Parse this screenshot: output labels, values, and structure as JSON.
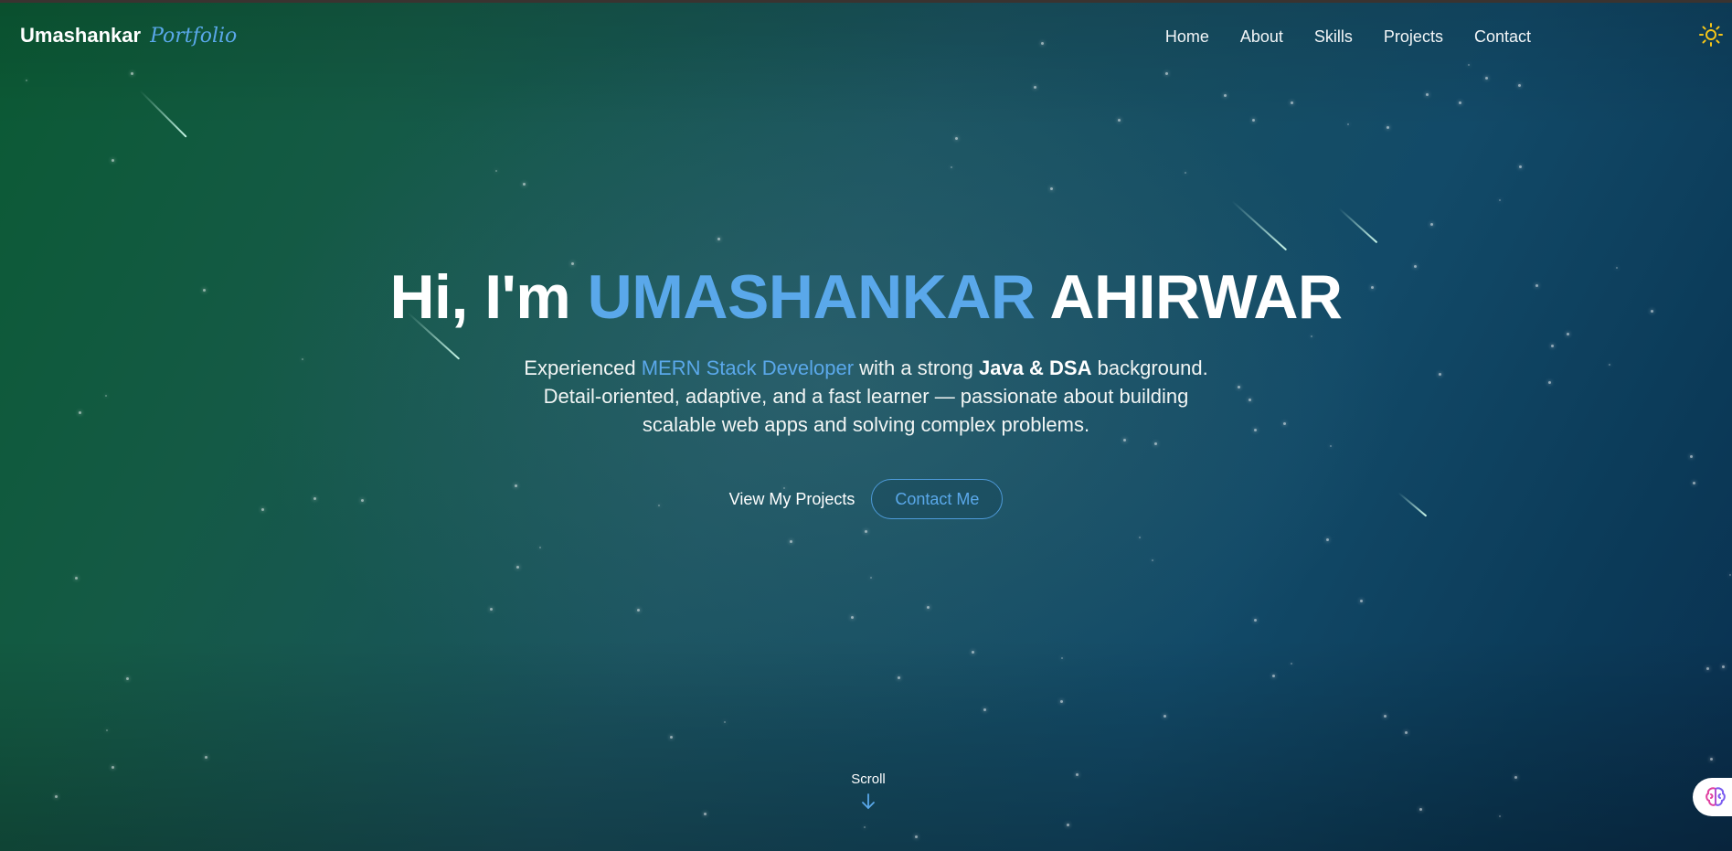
{
  "nav": {
    "brand_name": "Umashankar",
    "brand_sub": "Portfolio",
    "links": [
      "Home",
      "About",
      "Skills",
      "Projects",
      "Contact"
    ]
  },
  "hero": {
    "greeting": "Hi, I'm",
    "first_name": "UMASHANKAR",
    "last_name": "AHIRWAR",
    "desc_1": "Experienced ",
    "desc_highlight": "MERN Stack Developer",
    "desc_2": " with a strong ",
    "desc_bold": "Java & DSA",
    "desc_3": " background. Detail-oriented, adaptive, and a fast learner — passionate about building scalable web apps and solving complex problems.",
    "btn_projects": "View My Projects",
    "btn_contact": "Contact Me"
  },
  "scroll_label": "Scroll",
  "icons": {
    "theme": "sun-icon",
    "scroll": "arrow-down-icon",
    "assistant": "brain-icon"
  },
  "colors": {
    "accent": "#5aa8ea",
    "sun": "#f5c518",
    "bg_green": "#0b5a34",
    "bg_blue": "#0b3a58"
  }
}
